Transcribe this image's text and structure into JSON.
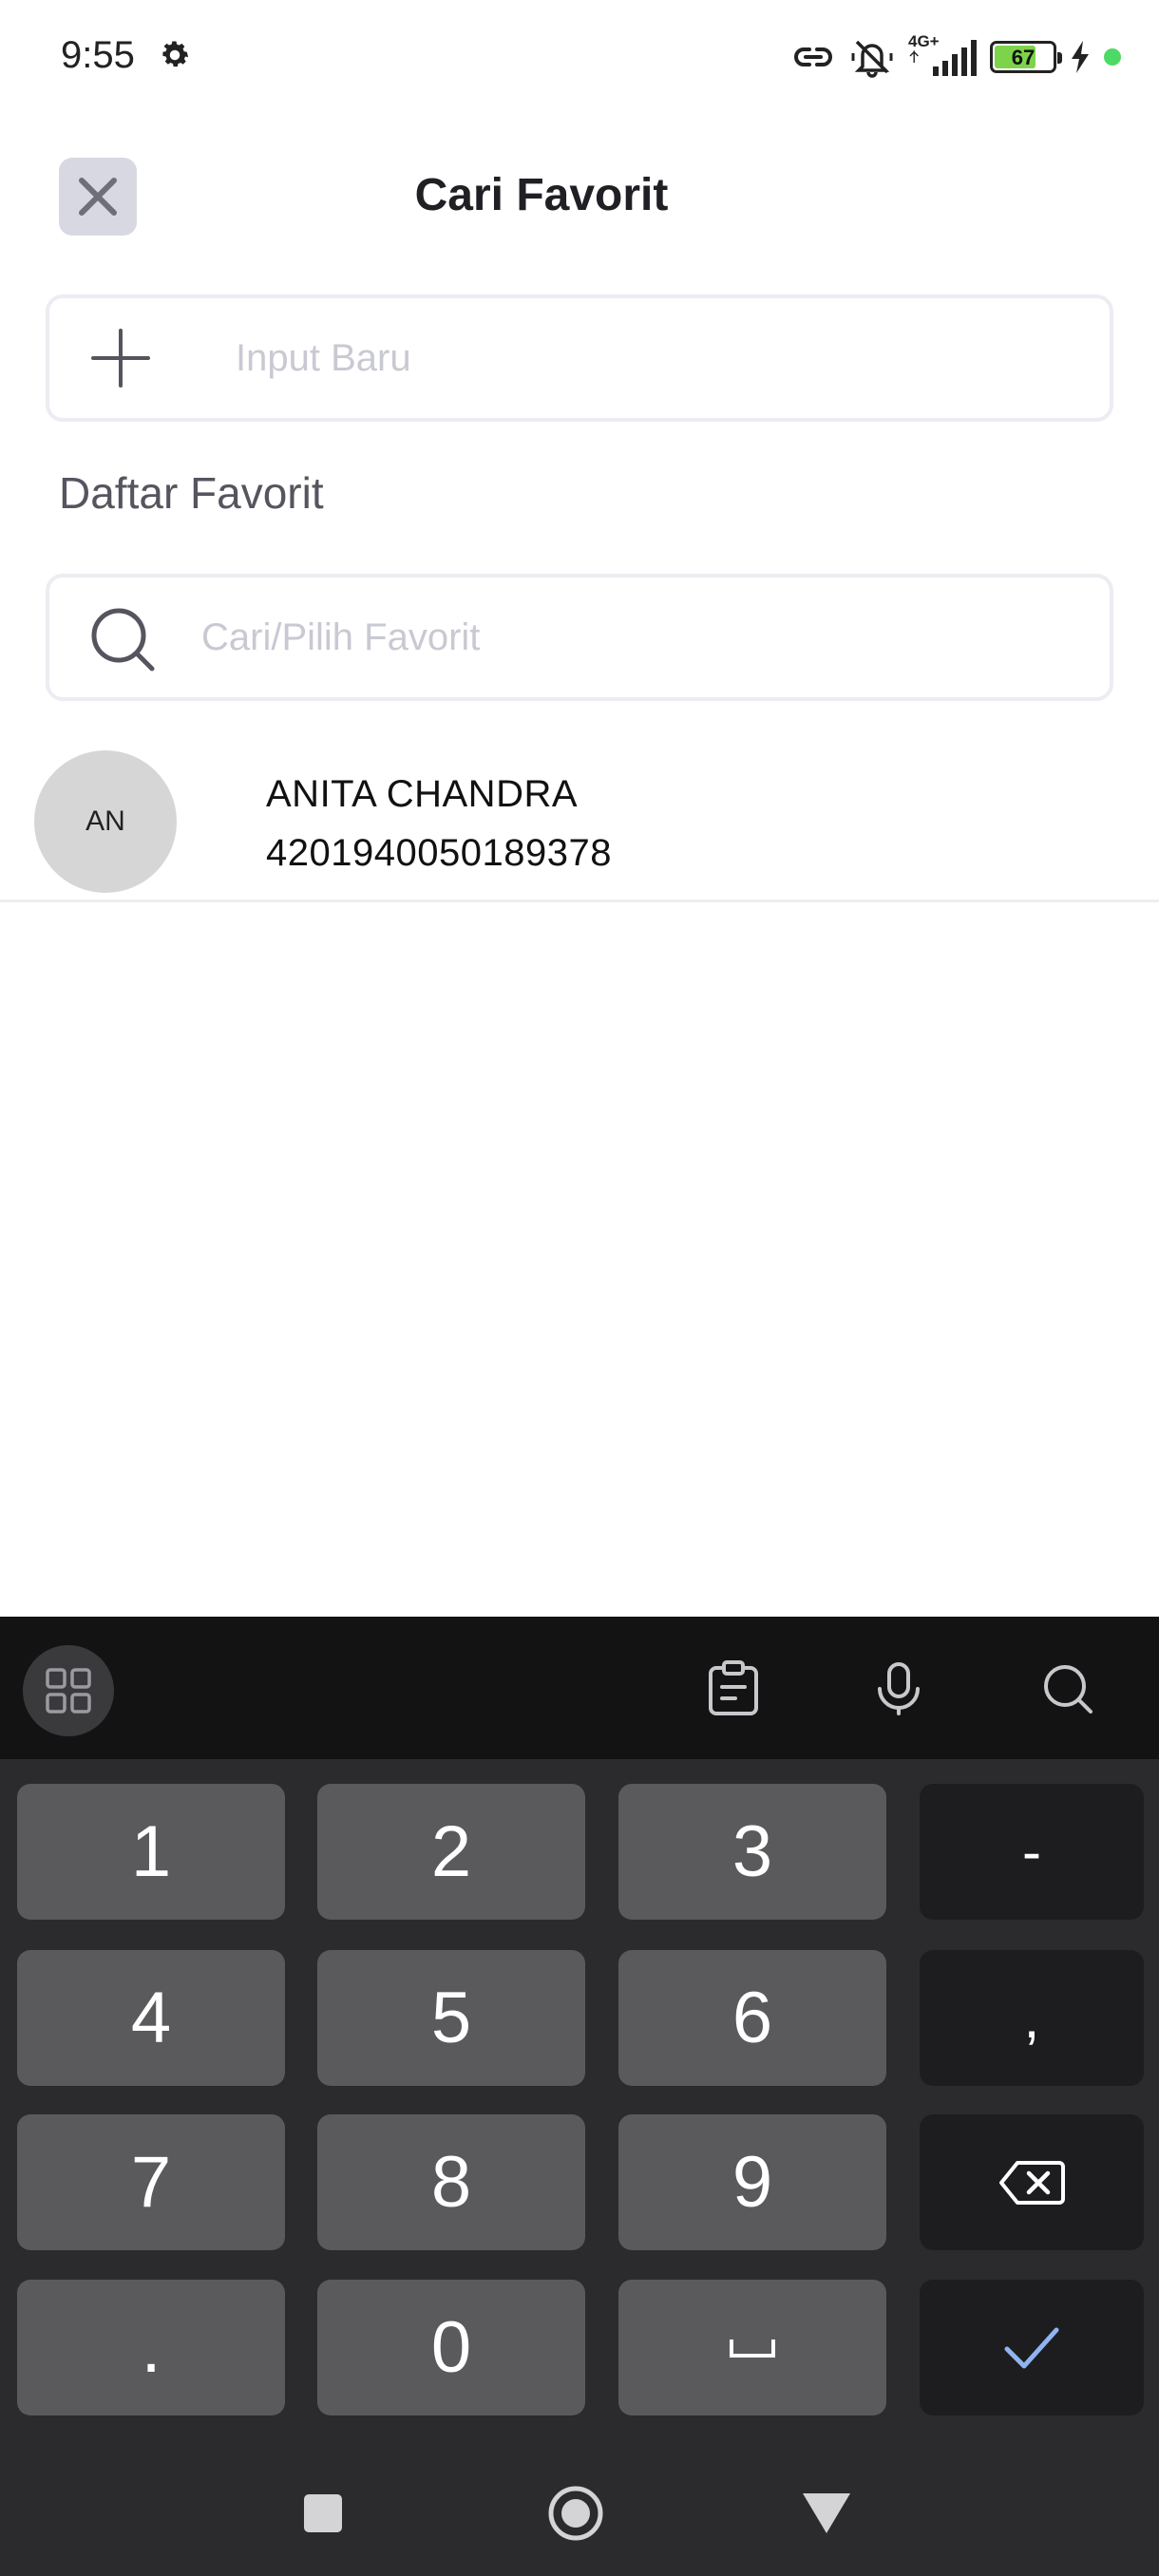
{
  "status_bar": {
    "time": "9:55",
    "battery": "67",
    "network": "4G+",
    "icons": [
      "settings-gear-icon",
      "link-icon",
      "mute-icon",
      "signal-icon",
      "battery-icon",
      "charging-icon",
      "status-dot-icon"
    ],
    "colors": {
      "battery_fill": "#7dd34a",
      "dot": "#4cd964"
    }
  },
  "header": {
    "title": "Cari Favorit",
    "close_icon": "close-icon"
  },
  "new_input": {
    "placeholder": "Input Baru",
    "icon": "plus-icon"
  },
  "favorites": {
    "section_title": "Daftar Favorit",
    "search_placeholder": "Cari/Pilih Favorit",
    "items": [
      {
        "initials": "AN",
        "name": "ANITA CHANDRA",
        "number": "4201940050189378"
      }
    ]
  },
  "keyboard": {
    "toolbar_icons": [
      "apps-grid-icon",
      "clipboard-icon",
      "microphone-icon",
      "search-icon"
    ],
    "keys": {
      "k1": "1",
      "k2": "2",
      "k3": "3",
      "minus": "-",
      "k4": "4",
      "k5": "5",
      "k6": "6",
      "comma": ",",
      "k7": "7",
      "k8": "8",
      "k9": "9",
      "backspace_icon": "backspace-icon",
      "dot": ".",
      "k0": "0",
      "space": "␣",
      "enter_icon": "checkmark-icon"
    },
    "colors": {
      "key": "#5a5a5c",
      "side_key": "#1d1d1f",
      "enter_check": "#8fb4f0"
    }
  },
  "nav_bar": {
    "icons": [
      "recent-apps-icon",
      "home-icon",
      "back-icon"
    ]
  }
}
